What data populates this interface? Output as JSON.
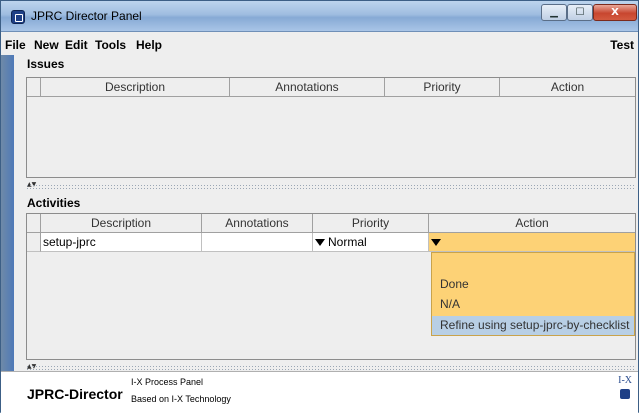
{
  "window": {
    "title": "JPRC Director Panel"
  },
  "titlebar_buttons": {
    "minimize": "▁",
    "maximize": "☐",
    "close": "X"
  },
  "menu": {
    "items": [
      "File",
      "New",
      "Edit",
      "Tools",
      "Help"
    ],
    "right": "Test"
  },
  "issues": {
    "label": "Issues",
    "columns": [
      "Description",
      "Annotations",
      "Priority",
      "Action"
    ],
    "rows": []
  },
  "activities": {
    "label": "Activities",
    "columns": [
      "Description",
      "Annotations",
      "Priority",
      "Action"
    ],
    "rows": [
      {
        "description": "setup-jprc",
        "annotations": "",
        "priority": "Normal",
        "action": ""
      }
    ]
  },
  "action_menu": {
    "options": [
      "",
      "Done",
      "N/A",
      "Refine using setup-jprc-by-checklist"
    ],
    "highlighted": "Refine using setup-jprc-by-checklist"
  },
  "footer": {
    "brand": "JPRC-Director",
    "line1": "I-X Process Panel",
    "line2": "Based on I-X Technology",
    "logo_text": "I-X"
  },
  "colors": {
    "popup_bg": "#fdd276",
    "highlight": "#b8cfe5",
    "titlebar": "#9fbde0",
    "close_button": "#c8462f"
  }
}
